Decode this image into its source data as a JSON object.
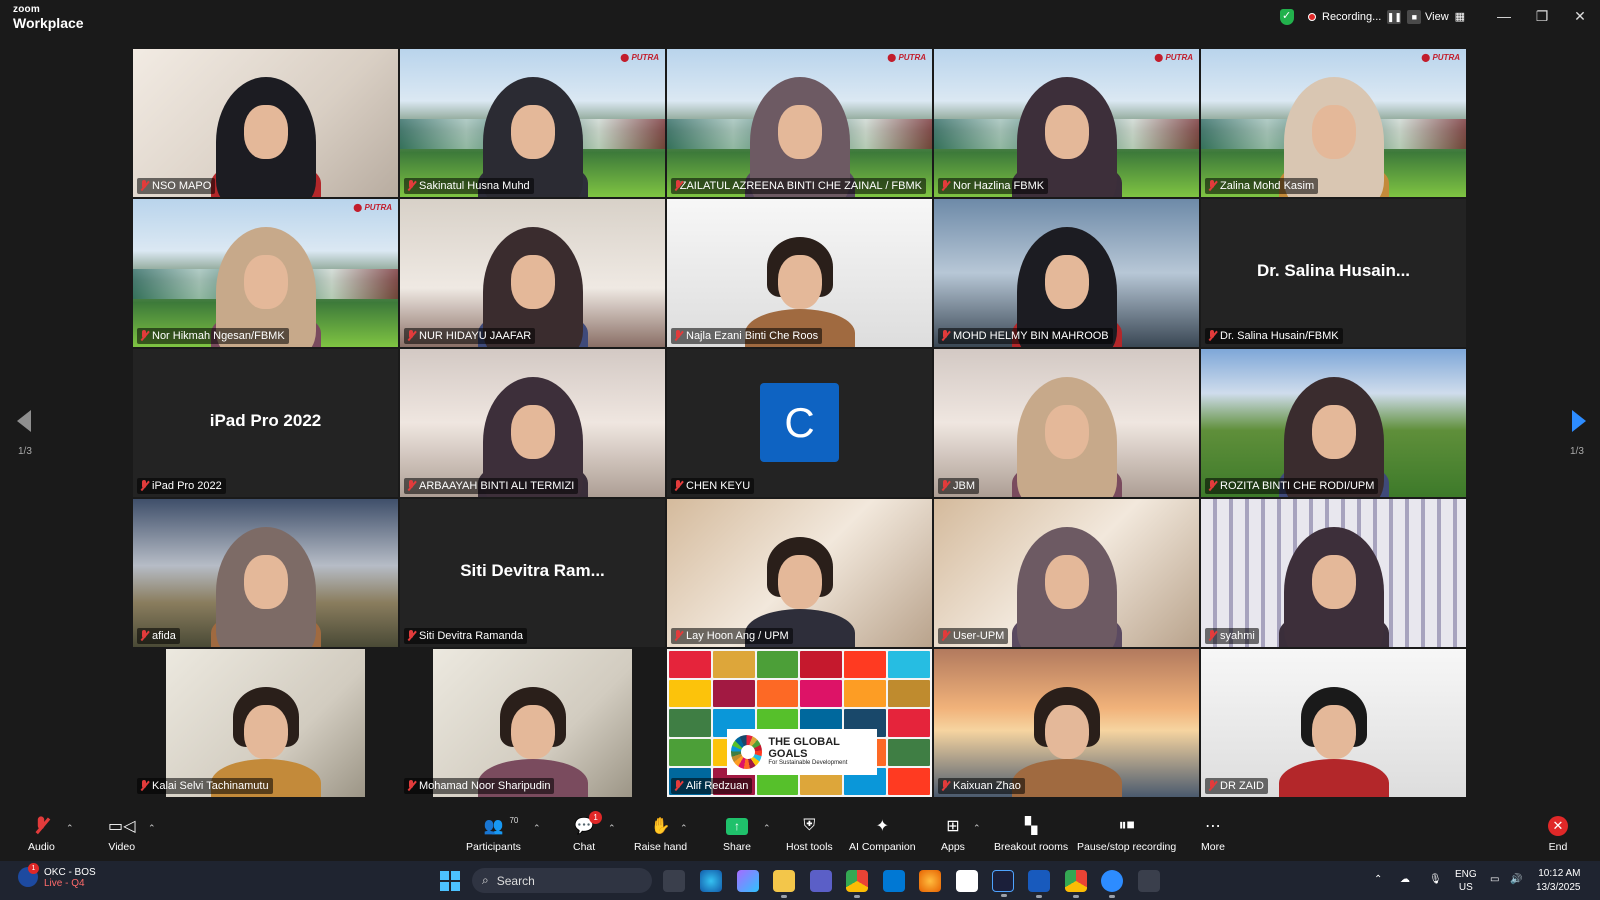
{
  "app": {
    "logo_line1": "zoom",
    "logo_line2": "Workplace"
  },
  "titlebar": {
    "recording_label": "Recording...",
    "view_label": "View"
  },
  "participants": [
    {
      "name": "NSO MAPO",
      "bg": "bg-room"
    },
    {
      "name": "Sakinatul Husna Muhd",
      "bg": "bg-upm"
    },
    {
      "name": "ZAILATUL AZREENA BINTI CHE ZAINAL / FBMK",
      "bg": "bg-upm"
    },
    {
      "name": "Nor Hazlina FBMK",
      "bg": "bg-upm",
      "active": true
    },
    {
      "name": "Zalina Mohd Kasim",
      "bg": "bg-upm"
    },
    {
      "name": "Nor Hikmah Ngesan/FBMK",
      "bg": "bg-upm"
    },
    {
      "name": "NUR HIDAYU JAAFAR",
      "bg": "bg-room2"
    },
    {
      "name": "Najla Ezani Binti Che Roos",
      "bg": "bg-white"
    },
    {
      "name": "MOHD HELMY BIN MAHROOB",
      "bg": "bg-office"
    },
    {
      "name": "Dr. Salina Husain/FBMK",
      "bg": "bg-dark",
      "display_name": "Dr. Salina Husain..."
    },
    {
      "name": "iPad Pro 2022",
      "bg": "bg-dark",
      "display_name": "iPad Pro 2022"
    },
    {
      "name": "ARBAAYAH BINTI ALI TERMIZI",
      "bg": "bg-dim"
    },
    {
      "name": "CHEN KEYU",
      "bg": "bg-dark",
      "avatar_letter": "C"
    },
    {
      "name": "JBM",
      "bg": "bg-dim"
    },
    {
      "name": "ROZITA BINTI CHE RODI/UPM",
      "bg": "bg-campus"
    },
    {
      "name": "afida",
      "bg": "bg-sky"
    },
    {
      "name": "Siti Devitra Ramanda",
      "bg": "bg-dark",
      "display_name": "Siti Devitra Ram..."
    },
    {
      "name": "Lay Hoon Ang / UPM",
      "bg": "bg-blur"
    },
    {
      "name": "User-UPM",
      "bg": "bg-blur"
    },
    {
      "name": "syahmi",
      "bg": "bg-curtain"
    },
    {
      "name": "Kalai Selvi Tachinamutu",
      "bg": "bg-shelf"
    },
    {
      "name": "Mohamad Noor Sharipudin",
      "bg": "bg-shelf"
    },
    {
      "name": "Alif Redzuan",
      "bg": "bg-sdg",
      "sdg_title": "THE GLOBAL GOALS",
      "sdg_sub": "For Sustainable Development"
    },
    {
      "name": "Kaixuan Zhao",
      "bg": "bg-bridge"
    },
    {
      "name": "DR ZAID",
      "bg": "bg-white"
    }
  ],
  "pagination": {
    "left": "1/3",
    "right": "1/3"
  },
  "toolbar": {
    "audio": "Audio",
    "video": "Video",
    "participants": "Participants",
    "participants_count": "70",
    "chat": "Chat",
    "chat_badge": "1",
    "raise_hand": "Raise hand",
    "share": "Share",
    "host_tools": "Host tools",
    "ai_companion": "AI Companion",
    "apps": "Apps",
    "breakout_rooms": "Breakout rooms",
    "pause_stop_recording": "Pause/stop recording",
    "more": "More",
    "end": "End"
  },
  "taskbar": {
    "weather_title": "OKC - BOS",
    "weather_sub": "Live - Q4",
    "weather_badge": "1",
    "search_placeholder": "Search",
    "lang1": "ENG",
    "lang2": "US",
    "time": "10:12 AM",
    "date": "13/3/2025"
  },
  "colors": {
    "accent": "#2d8cff",
    "active_speaker": "#3ee07a",
    "recording": "#e02828",
    "share": "#1fc16b"
  }
}
